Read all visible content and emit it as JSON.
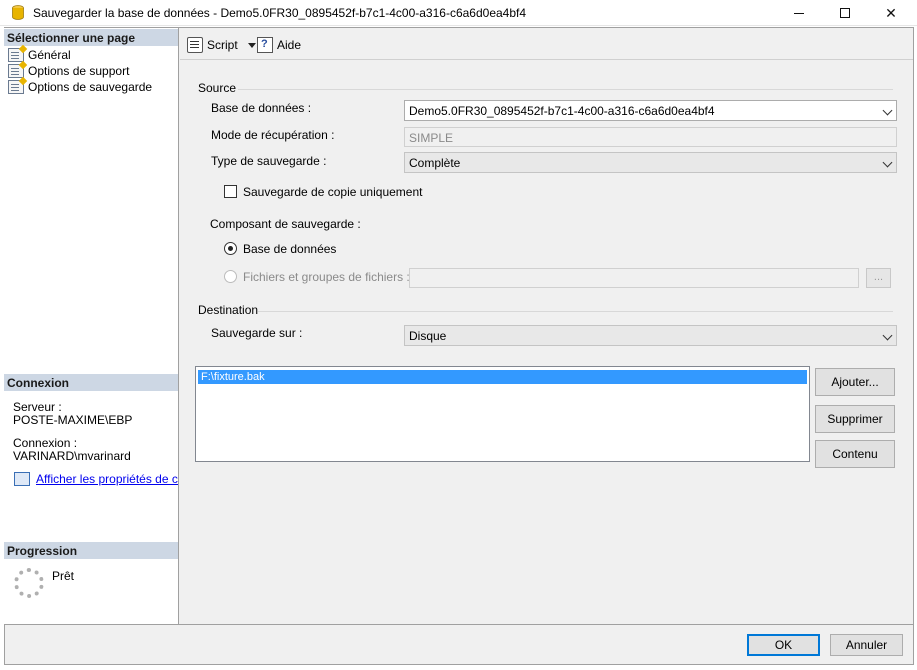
{
  "window": {
    "title": "Sauvegarder la base de données - Demo5.0FR30_0895452f-b7c1-4c00-a316-c6a6d0ea4bf4",
    "close_glyph": "✕"
  },
  "left_panel": {
    "select_page_header": "Sélectionner une page",
    "pages": [
      {
        "label": "Général"
      },
      {
        "label": "Options de support"
      },
      {
        "label": "Options de sauvegarde"
      }
    ],
    "connection_header": "Connexion",
    "server_label": "Serveur :",
    "server_value": "POSTE-MAXIME\\EBP",
    "connection_label": "Connexion :",
    "connection_value": "VARINARD\\mvarinard",
    "properties_link": "Afficher les propriétés de conn",
    "progress_header": "Progression",
    "progress_status": "Prêt"
  },
  "toolbar": {
    "script_label": "Script",
    "help_label": "Aide"
  },
  "source": {
    "group_label": "Source",
    "database_label": "Base de données :",
    "database_value": "Demo5.0FR30_0895452f-b7c1-4c00-a316-c6a6d0ea4bf4",
    "recovery_label": "Mode de récupération :",
    "recovery_value": "SIMPLE",
    "backup_type_label": "Type de sauvegarde :",
    "backup_type_value": "Complète",
    "copy_only_label": "Sauvegarde de copie uniquement",
    "component_label": "Composant de sauvegarde :",
    "radio_database_label": "Base de données",
    "radio_files_label": "Fichiers et groupes de fichiers :",
    "ellipsis_label": "..."
  },
  "destination": {
    "group_label": "Destination",
    "backup_to_label": "Sauvegarde sur :",
    "backup_to_value": "Disque",
    "files": [
      "F:\\fixture.bak"
    ],
    "add_button": "Ajouter...",
    "remove_button": "Supprimer",
    "contents_button": "Contenu"
  },
  "footer": {
    "ok_button": "OK",
    "cancel_button": "Annuler"
  },
  "state": {
    "copy_only_checked": false,
    "component_selected": "database",
    "files_option_enabled": false
  },
  "colors": {
    "selection": "#3399ff",
    "header_band": "#cdd7e4",
    "link": "#0000ee",
    "default_button_border": "#0078d7"
  }
}
